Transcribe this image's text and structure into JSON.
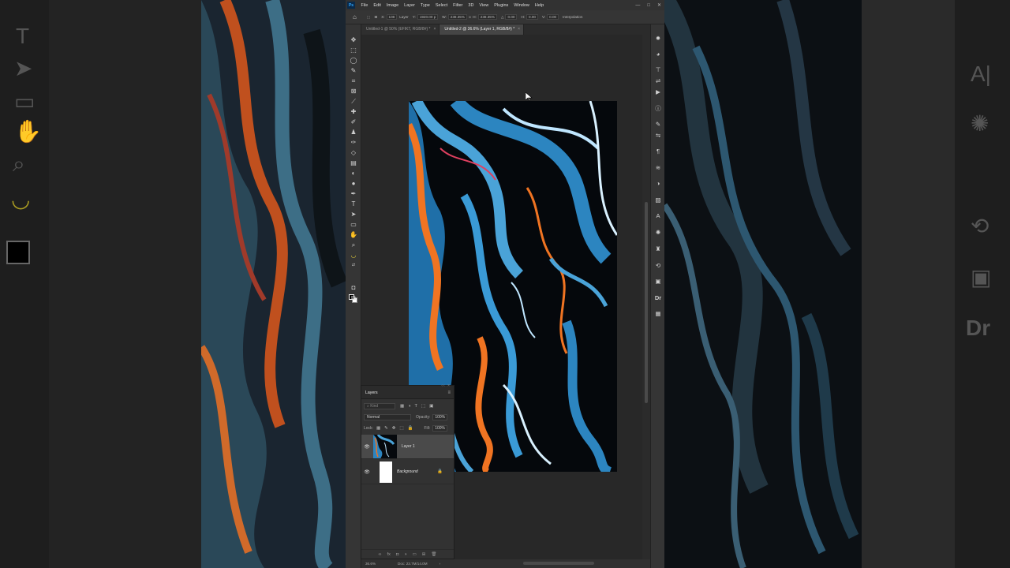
{
  "app": {
    "logo": "Ps"
  },
  "menu": [
    "File",
    "Edit",
    "Image",
    "Layer",
    "Type",
    "Select",
    "Filter",
    "3D",
    "View",
    "Plugins",
    "Window",
    "Help"
  ],
  "window_controls": [
    "—",
    "□",
    "✕"
  ],
  "options": {
    "home_icon": "home-icon",
    "layer_label": "Layer",
    "x_label": "X:",
    "x_value": "108",
    "y_label": "Y:",
    "y_value": "1920.00 p",
    "w_label": "W:",
    "w_value": "238.35%",
    "h_label": "H:",
    "h_value": "238.35%",
    "angle_label": "△",
    "angle_value": "0.00",
    "hskew_label": "H:",
    "hskew_value": "0.00",
    "vskew_label": "V:",
    "vskew_value": "0.00",
    "interpolation": "Interpolation"
  },
  "tabs": [
    {
      "label": "Untitled-1 @ 50% (EFIKT, RGB/8#) *",
      "active": false
    },
    {
      "label": "Untitled-2 @ 36.6% (Layer 1, RGB/8#) *",
      "active": true
    }
  ],
  "layers_panel": {
    "title": "Layers",
    "kind_placeholder": "Kind",
    "blend_mode": "Normal",
    "opacity_label": "Opacity:",
    "opacity_value": "100%",
    "lock_label": "Lock:",
    "fill_label": "Fill:",
    "fill_value": "100%",
    "layers": [
      {
        "name": "Layer 1",
        "selected": true
      },
      {
        "name": "Background",
        "selected": false
      }
    ]
  },
  "status": {
    "zoom": "36.6%",
    "doc": "Doc: 23.7M/14.0M"
  },
  "background_glyphs": {
    "text_tool": "T",
    "char_panel": "A|",
    "dr_panel": "Dr"
  }
}
